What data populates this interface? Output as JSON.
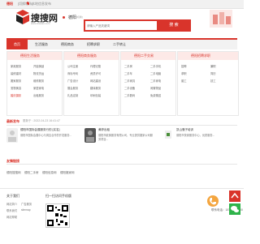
{
  "topbar": {
    "city": "德阳",
    "switch": "[切换城市]",
    "link": "本地信息发布"
  },
  "logo": {
    "text": "搜搜网",
    "sub": "www.dnsoso.com"
  },
  "city": {
    "name": "德阳",
    "sub": "[切换]"
  },
  "search": {
    "placeholder": "请输入产品关键词",
    "button": "搜 索"
  },
  "nav": {
    "items": [
      "首页",
      "生活服务",
      "德阳商务",
      "招聘求职",
      "二手转让"
    ]
  },
  "panels": [
    {
      "title": "德阳生活服务",
      "items": [
        "家政服务",
        "开锁换锁",
        "装修建材",
        "物流货运",
        "搬家服务",
        "维修服务",
        "宠物美容",
        "家居家电",
        "出租服务",
        "健身运动",
        "公司注册",
        "教育培训",
        "广告策划",
        "其他生活",
        "婚庆摄影"
      ]
    },
    {
      "title": "德阳商务服务",
      "items": [
        "公司注册",
        "代理记账",
        "商标专利",
        "资质许可",
        "广告设计",
        "网站建设",
        "展会服务",
        "翻译服务",
        "礼品定制",
        "印刷包装",
        "项目合作",
        "其他商务"
      ]
    },
    {
      "title": "德阳二手交易",
      "items": [
        "二手房",
        "二手手机",
        "二手车",
        "二手电脑",
        "二手家具",
        "二手家电",
        "二手设备",
        "闲置物品",
        "二手数码",
        "免费赠送",
        "回收",
        "其他二手"
      ]
    },
    {
      "title": "德阳招聘求职",
      "items": [
        "招聘",
        "兼职",
        "求职",
        "简历",
        "普工",
        "技工"
      ]
    }
  ],
  "news": {
    "title": "最新发布",
    "time": "更新于 : 2022-04-23 16:41:47",
    "items": [
      {
        "name": "德阳市国际会展服务行的 [实名]",
        "desc": "德阳市国际会展中心与周边合作的开发服务..."
      },
      {
        "name": "黄婷出租",
        "desc": "德阳市欧美服务有限公司，专业提供搬家公司服务项目..."
      },
      {
        "name": "凯山骆子培训",
        "desc": "德阳市快家服务中心，优质服务..."
      }
    ]
  },
  "friends": {
    "title": "友情链接",
    "links": [
      "德阳搜搜网",
      "德阳二手房",
      "德阳信息网",
      "德阳搬家网"
    ]
  },
  "footer": {
    "about_title": "关于我们",
    "about_links": [
      "网站简介",
      "广告服务",
      "联系我们",
      "sitemap",
      "网站帮助"
    ],
    "qr_title": "扫一扫访问手机版",
    "tel": "联系电话：18700707700"
  },
  "colors": {
    "accent": "#d9342b",
    "panel_head_bg": "#fde9e7"
  }
}
